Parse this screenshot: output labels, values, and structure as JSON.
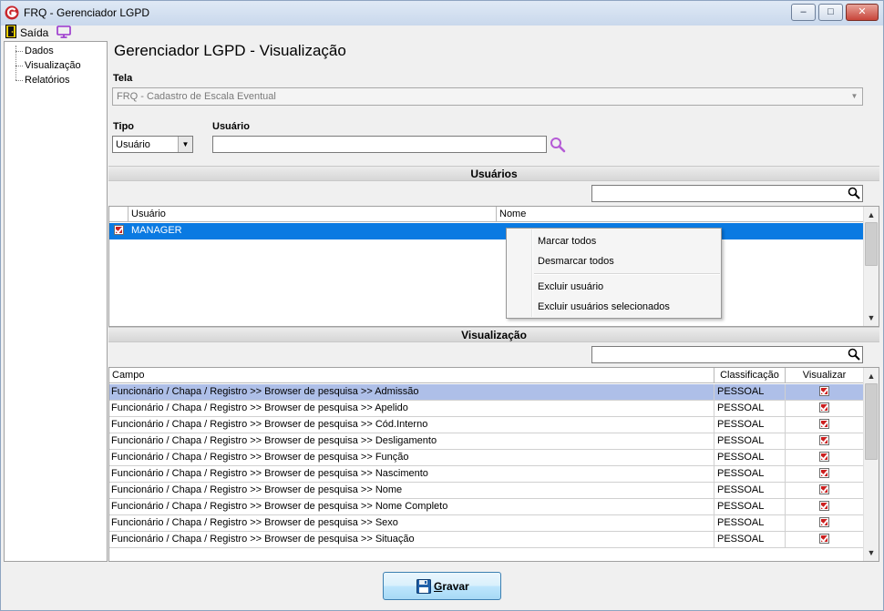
{
  "window": {
    "title": "FRQ - Gerenciador LGPD",
    "min_glyph": "–",
    "max_glyph": "□",
    "close_glyph": "✕"
  },
  "menubar": {
    "exit_label": "Saída"
  },
  "tree": {
    "items": [
      "Dados",
      "Visualização",
      "Relatórios"
    ]
  },
  "page": {
    "title": "Gerenciador LGPD - Visualização"
  },
  "form": {
    "tela_label": "Tela",
    "tela_value": "FRQ - Cadastro de Escala Eventual",
    "tipo_label": "Tipo",
    "tipo_value": "Usuário",
    "usuario_label": "Usuário",
    "usuario_value": ""
  },
  "usuarios_section": {
    "title": "Usuários",
    "filter_value": "",
    "columns": [
      "Usuário",
      "Nome"
    ],
    "rows": [
      {
        "checked": true,
        "usuario": "MANAGER",
        "nome": ""
      }
    ]
  },
  "context_menu": {
    "items": [
      "Marcar todos",
      "Desmarcar todos",
      "Excluir usuário",
      "Excluir usuários selecionados"
    ]
  },
  "visualizacao_section": {
    "title": "Visualização",
    "filter_value": "",
    "columns": [
      "Campo",
      "Classificação",
      "Visualizar"
    ],
    "rows": [
      {
        "campo": "Funcionário / Chapa / Registro >> Browser de pesquisa >> Admissão",
        "classificacao": "PESSOAL",
        "visualizar": true
      },
      {
        "campo": "Funcionário / Chapa / Registro >> Browser de pesquisa >> Apelido",
        "classificacao": "PESSOAL",
        "visualizar": true
      },
      {
        "campo": "Funcionário / Chapa / Registro >> Browser de pesquisa >> Cód.Interno",
        "classificacao": "PESSOAL",
        "visualizar": true
      },
      {
        "campo": "Funcionário / Chapa / Registro >> Browser de pesquisa >> Desligamento",
        "classificacao": "PESSOAL",
        "visualizar": true
      },
      {
        "campo": "Funcionário / Chapa / Registro >> Browser de pesquisa >> Função",
        "classificacao": "PESSOAL",
        "visualizar": true
      },
      {
        "campo": "Funcionário / Chapa / Registro >> Browser de pesquisa >> Nascimento",
        "classificacao": "PESSOAL",
        "visualizar": true
      },
      {
        "campo": "Funcionário / Chapa / Registro >> Browser de pesquisa >> Nome",
        "classificacao": "PESSOAL",
        "visualizar": true
      },
      {
        "campo": "Funcionário / Chapa / Registro >> Browser de pesquisa >> Nome Completo",
        "classificacao": "PESSOAL",
        "visualizar": true
      },
      {
        "campo": "Funcionário / Chapa / Registro >> Browser de pesquisa >> Sexo",
        "classificacao": "PESSOAL",
        "visualizar": true
      },
      {
        "campo": "Funcionário / Chapa / Registro >> Browser de pesquisa >> Situação",
        "classificacao": "PESSOAL",
        "visualizar": true
      }
    ]
  },
  "save_button": {
    "mnemonic": "G",
    "rest": "ravar"
  },
  "colors": {
    "selection_blue": "#0a7ae2",
    "highlight_row": "#aebfe8",
    "check_red": "#cc1f1f",
    "accent_purple": "#9932cc"
  }
}
